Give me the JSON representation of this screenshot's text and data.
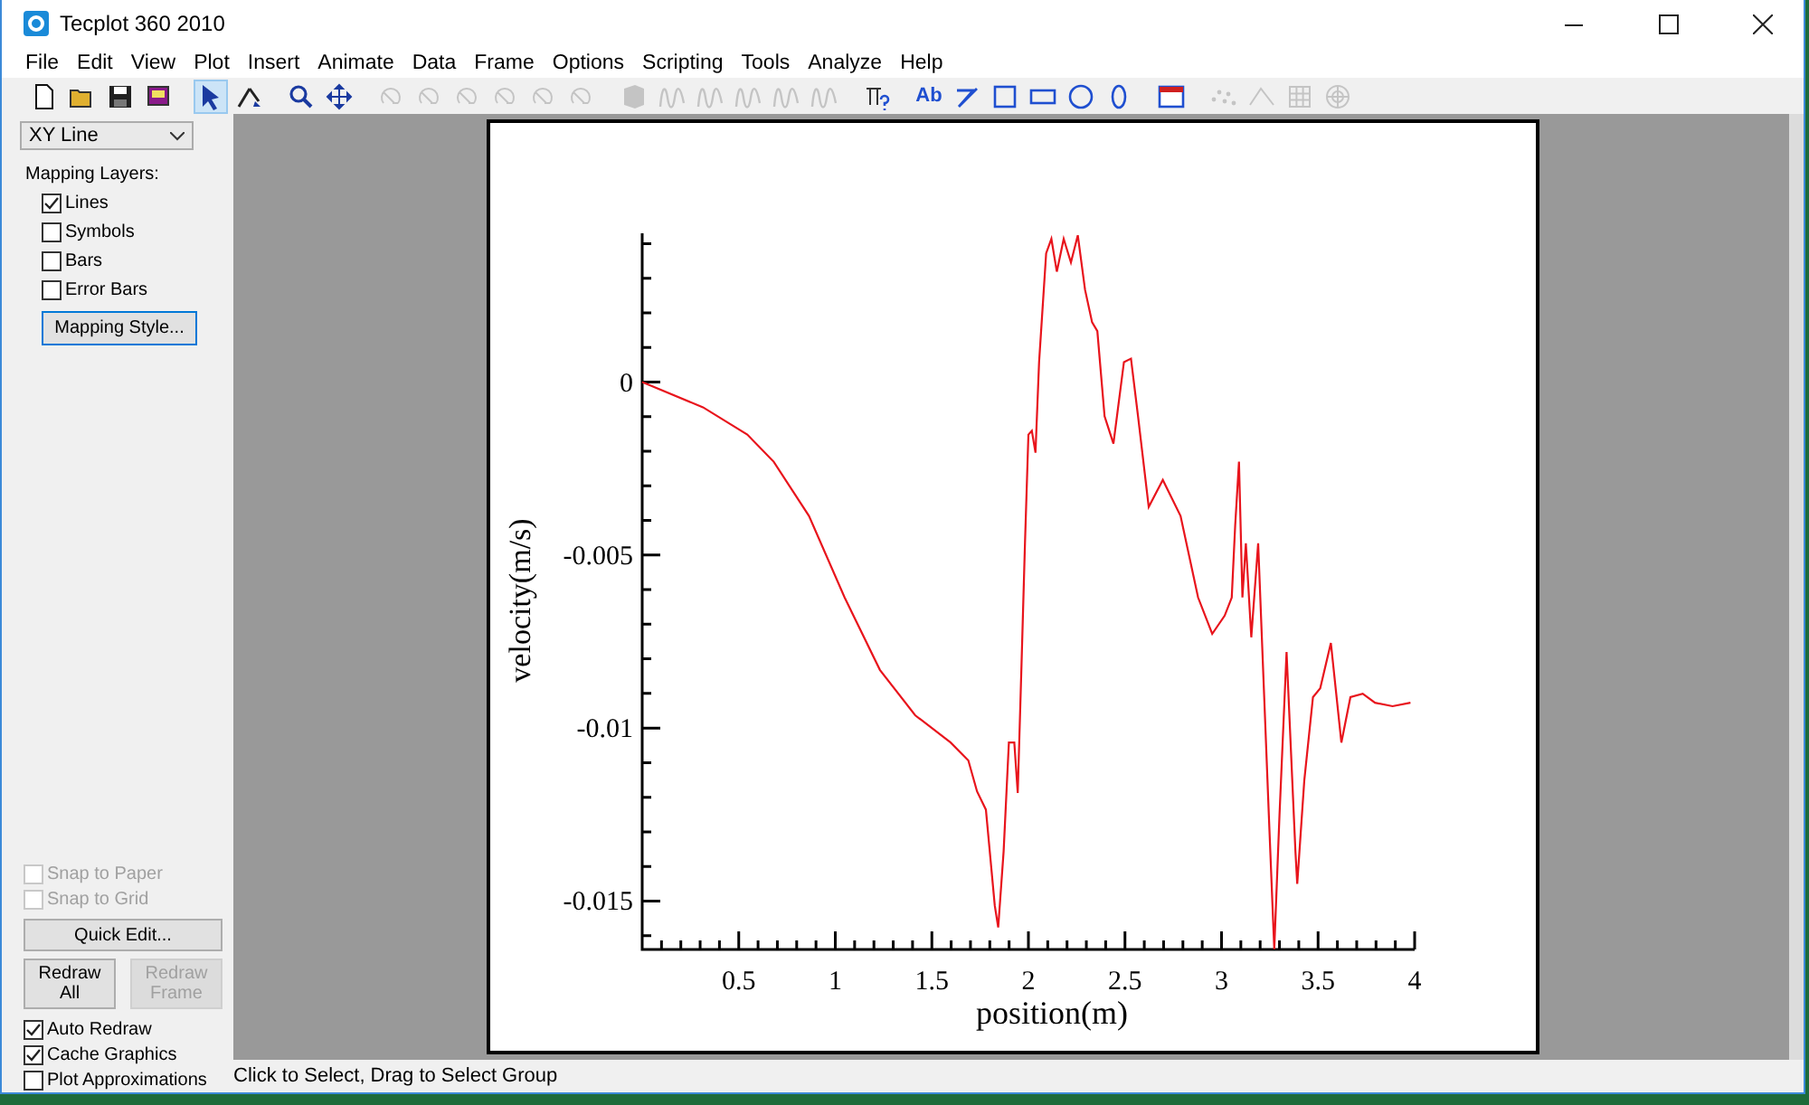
{
  "window": {
    "title": "Tecplot 360 2010"
  },
  "menu": [
    "File",
    "Edit",
    "View",
    "Plot",
    "Insert",
    "Animate",
    "Data",
    "Frame",
    "Options",
    "Scripting",
    "Tools",
    "Analyze",
    "Help"
  ],
  "toolbar": {
    "tools": [
      {
        "kind": "new",
        "selected": false,
        "disabled": false
      },
      {
        "kind": "open",
        "selected": false,
        "disabled": false
      },
      {
        "kind": "save",
        "selected": false,
        "disabled": false
      },
      {
        "kind": "print",
        "selected": false,
        "disabled": false
      },
      {
        "kind": "pointer",
        "selected": true,
        "disabled": false
      },
      {
        "kind": "adjustor",
        "selected": false,
        "disabled": false
      },
      {
        "kind": "zoom",
        "selected": false,
        "disabled": false
      },
      {
        "kind": "pan",
        "selected": false,
        "disabled": false
      },
      {
        "kind": "rotate",
        "selected": false,
        "disabled": true
      },
      {
        "kind": "rotate",
        "selected": false,
        "disabled": true
      },
      {
        "kind": "rotate",
        "selected": false,
        "disabled": true
      },
      {
        "kind": "rotate",
        "selected": false,
        "disabled": true
      },
      {
        "kind": "rotate",
        "selected": false,
        "disabled": true
      },
      {
        "kind": "rotate",
        "selected": false,
        "disabled": true
      },
      {
        "kind": "block",
        "selected": false,
        "disabled": true
      },
      {
        "kind": "squiggle",
        "selected": false,
        "disabled": true
      },
      {
        "kind": "squiggle",
        "selected": false,
        "disabled": true
      },
      {
        "kind": "squiggle",
        "selected": false,
        "disabled": true
      },
      {
        "kind": "squiggle",
        "selected": false,
        "disabled": true
      },
      {
        "kind": "squiggle",
        "selected": false,
        "disabled": true
      },
      {
        "kind": "probe",
        "selected": false,
        "disabled": false
      },
      {
        "kind": "text",
        "label": "Ab",
        "selected": false,
        "disabled": false
      },
      {
        "kind": "polyline",
        "selected": false,
        "disabled": false
      },
      {
        "kind": "square",
        "selected": false,
        "disabled": false
      },
      {
        "kind": "rectangle",
        "selected": false,
        "disabled": false
      },
      {
        "kind": "circle",
        "selected": false,
        "disabled": false
      },
      {
        "kind": "ellipse",
        "selected": false,
        "disabled": false
      },
      {
        "kind": "frame",
        "selected": false,
        "disabled": false
      },
      {
        "kind": "scatter",
        "selected": false,
        "disabled": true
      },
      {
        "kind": "polyline-points",
        "selected": false,
        "disabled": true
      },
      {
        "kind": "grid",
        "selected": false,
        "disabled": true
      },
      {
        "kind": "polar",
        "selected": false,
        "disabled": true
      }
    ]
  },
  "sidebar": {
    "plot_type": "XY Line",
    "layers_heading": "Mapping Layers:",
    "layers": [
      {
        "label": "Lines",
        "checked": true
      },
      {
        "label": "Symbols",
        "checked": false
      },
      {
        "label": "Bars",
        "checked": false
      },
      {
        "label": "Error Bars",
        "checked": false
      }
    ],
    "mapping_style_button": "Mapping Style...",
    "snap_options": [
      {
        "label": "Snap to Paper",
        "checked": false,
        "disabled": true
      },
      {
        "label": "Snap to Grid",
        "checked": false,
        "disabled": true
      }
    ],
    "quick_edit_button": "Quick Edit...",
    "redraw_buttons": [
      {
        "label": "Redraw\nAll",
        "disabled": false
      },
      {
        "label": "Redraw\nFrame",
        "disabled": true
      }
    ],
    "options": [
      {
        "label": "Auto Redraw",
        "checked": true
      },
      {
        "label": "Cache Graphics",
        "checked": true
      },
      {
        "label": "Plot Approximations",
        "checked": false
      }
    ]
  },
  "plot": {
    "chart_data": {
      "type": "line",
      "xlabel": "position(m)",
      "ylabel": "velocity(m/s)",
      "x": [
        0,
        0.315,
        0.544,
        0.681,
        0.864,
        1.048,
        1.231,
        1.414,
        1.597,
        1.689,
        1.734,
        1.78,
        1.826,
        1.844,
        1.872,
        1.899,
        1.927,
        1.945,
        1.963,
        1.982,
        2.0,
        2.018,
        2.037,
        2.055,
        2.092,
        2.119,
        2.147,
        2.183,
        2.22,
        2.256,
        2.293,
        2.33,
        2.357,
        2.394,
        2.44,
        2.495,
        2.531,
        2.568,
        2.623,
        2.696,
        2.788,
        2.879,
        2.952,
        3.016,
        3.053,
        3.071,
        3.09,
        3.108,
        3.126,
        3.154,
        3.19,
        3.245,
        3.273,
        3.3,
        3.337,
        3.383,
        3.392,
        3.429,
        3.474,
        3.511,
        3.566,
        3.621,
        3.667,
        3.731,
        3.795,
        3.886,
        3.978
      ],
      "series": [
        {
          "color": "#e8141c",
          "values": [
            0,
            -0.00073,
            -0.00152,
            -0.0023,
            -0.00387,
            -0.00623,
            -0.00832,
            -0.00963,
            -0.01042,
            -0.01094,
            -0.01183,
            -0.01236,
            -0.01513,
            -0.01576,
            -0.01356,
            -0.01042,
            -0.01042,
            -0.01188,
            -0.00832,
            -0.00466,
            -0.00152,
            -0.00141,
            -0.00204,
            0.00058,
            0.00372,
            0.00414,
            0.00319,
            0.00414,
            0.00346,
            0.00424,
            0.00267,
            0.00173,
            0.00147,
            -0.00099,
            -0.00178,
            0.00058,
            0.00068,
            -0.00099,
            -0.00361,
            -0.00283,
            -0.00387,
            -0.00623,
            -0.00728,
            -0.00675,
            -0.00623,
            -0.00414,
            -0.0023,
            -0.00623,
            -0.00466,
            -0.00738,
            -0.00466,
            -0.01251,
            -0.01639,
            -0.01251,
            -0.0078,
            -0.01356,
            -0.0145,
            -0.01152,
            -0.00911,
            -0.00885,
            -0.00754,
            -0.01042,
            -0.00911,
            -0.00901,
            -0.00927,
            -0.00937,
            -0.00927
          ]
        }
      ],
      "xlim": [
        0,
        4
      ],
      "ylim": [
        -0.0164,
        0.0043
      ],
      "xticks": [
        0.5,
        1,
        1.5,
        2,
        2.5,
        3,
        3.5,
        4
      ],
      "yticks": [
        0,
        {
          "value": -0.005,
          "label": "-0.005"
        },
        {
          "value": -0.01,
          "label": "-0.01"
        },
        {
          "value": -0.015,
          "label": "-0.015"
        }
      ]
    }
  },
  "status_bar": "Click to Select, Drag to Select Group"
}
